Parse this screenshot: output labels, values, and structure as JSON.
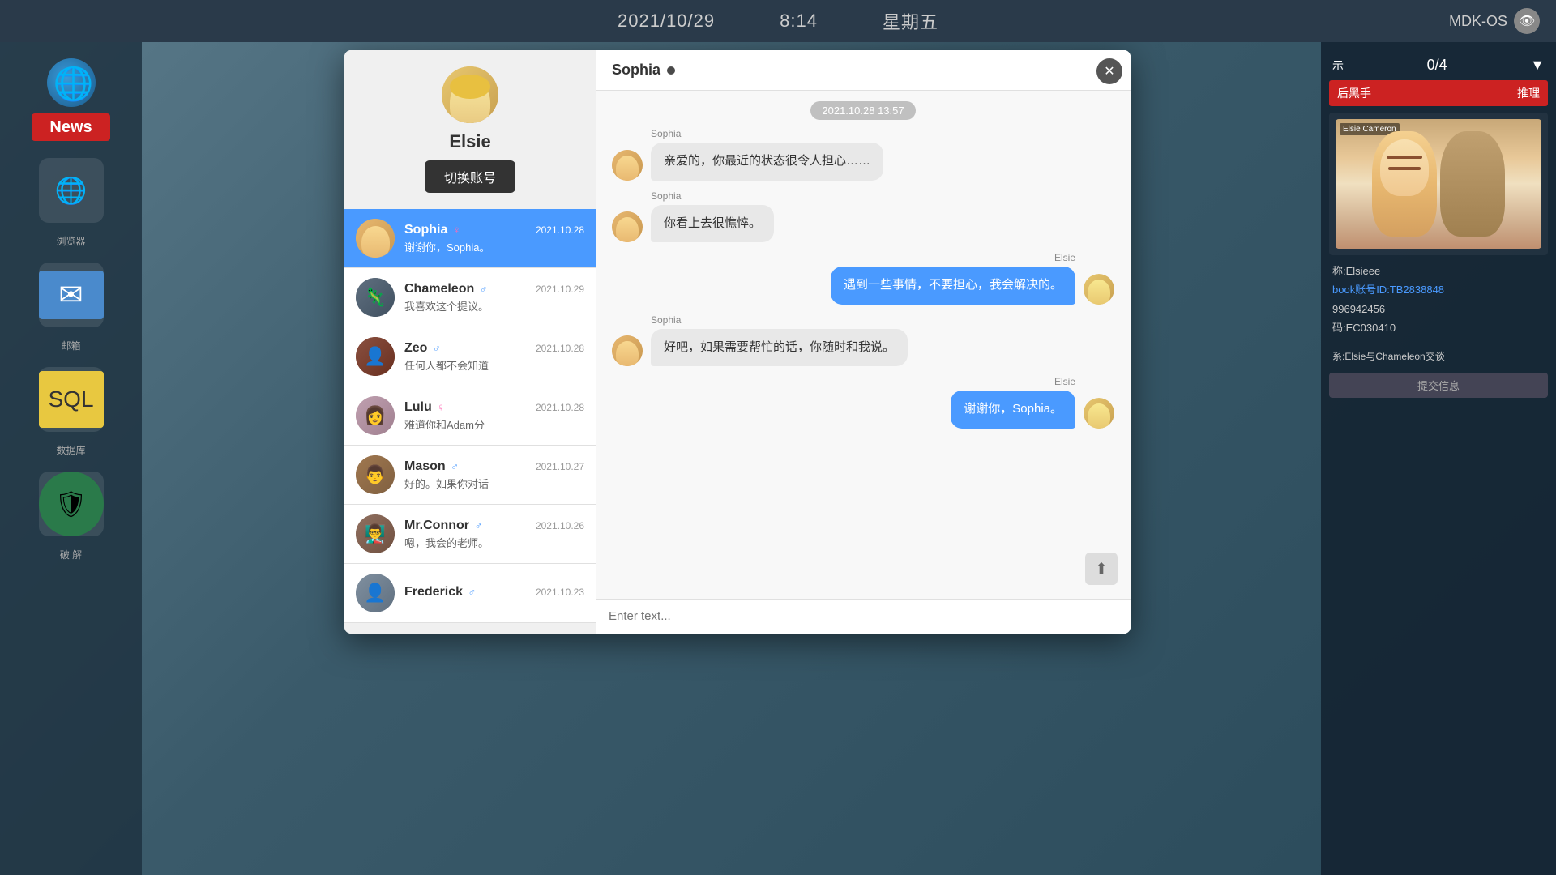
{
  "topbar": {
    "date": "2021/10/29",
    "time": "8:14",
    "day": "星期五",
    "system": "MDK-OS"
  },
  "left_panel": {
    "news_label": "News",
    "browser_label": "浏览器",
    "mail_label": "邮箱",
    "db_label": "数据库",
    "shield_label": "破 解"
  },
  "right_panel": {
    "counter": "0/4",
    "red_title": "后黑手",
    "reasoning_label": "推理",
    "char_label": "Elsie Cameron",
    "username_label": "称:Elsieee",
    "fb_label": "book账号ID:TB2838848",
    "phone_label": "996942456",
    "code_label": "码:EC030410",
    "relation_label": "系:Elsie与Chameleon交谈",
    "submit_label": "提交信息"
  },
  "modal": {
    "profile": {
      "name": "Elsie",
      "switch_btn": "切换账号"
    },
    "contacts": [
      {
        "name": "Sophia",
        "gender": "♀",
        "date": "2021.10.28",
        "preview": "谢谢你，Sophia。",
        "active": true,
        "avatar_class": "avatar-sophia"
      },
      {
        "name": "Chameleon",
        "gender": "♂",
        "date": "2021.10.29",
        "preview": "我喜欢这个提议。",
        "active": false,
        "avatar_class": "avatar-chameleon"
      },
      {
        "name": "Zeo",
        "gender": "♂",
        "date": "2021.10.28",
        "preview": "任何人都不会知道",
        "active": false,
        "avatar_class": "avatar-zeo"
      },
      {
        "name": "Lulu",
        "gender": "♀",
        "date": "2021.10.28",
        "preview": "难道你和Adam分",
        "active": false,
        "avatar_class": "avatar-lulu"
      },
      {
        "name": "Mason",
        "gender": "♂",
        "date": "2021.10.27",
        "preview": "好的。如果你对话",
        "active": false,
        "avatar_class": "avatar-mason"
      },
      {
        "name": "Mr.Connor",
        "gender": "♂",
        "date": "2021.10.26",
        "preview": "嗯，我会的老师。",
        "active": false,
        "avatar_class": "avatar-connor"
      },
      {
        "name": "Frederick",
        "gender": "♂",
        "date": "2021.10.23",
        "preview": "",
        "active": false,
        "avatar_class": "avatar-frederick"
      }
    ],
    "chat": {
      "contact_name": "Sophia",
      "time_divider": "2021.10.28  13:57",
      "messages": [
        {
          "type": "incoming",
          "sender": "Sophia",
          "text": "亲爱的，你最近的状态很令人担心……",
          "avatar_class": "avatar-sophia"
        },
        {
          "type": "incoming",
          "sender": "Sophia",
          "text": "你看上去很憔悴。",
          "avatar_class": "avatar-sophia"
        },
        {
          "type": "outgoing",
          "sender": "Elsie",
          "text": "遇到一些事情，不要担心，我会解决的。",
          "avatar_class": "avatar-sophia"
        },
        {
          "type": "incoming",
          "sender": "Sophia",
          "text": "好吧，如果需要帮忙的话，你随时和我说。",
          "avatar_class": "avatar-sophia"
        },
        {
          "type": "outgoing",
          "sender": "Elsie",
          "text": "谢谢你，Sophia。",
          "avatar_class": "avatar-sophia"
        }
      ],
      "input_placeholder": "Enter text..."
    }
  }
}
